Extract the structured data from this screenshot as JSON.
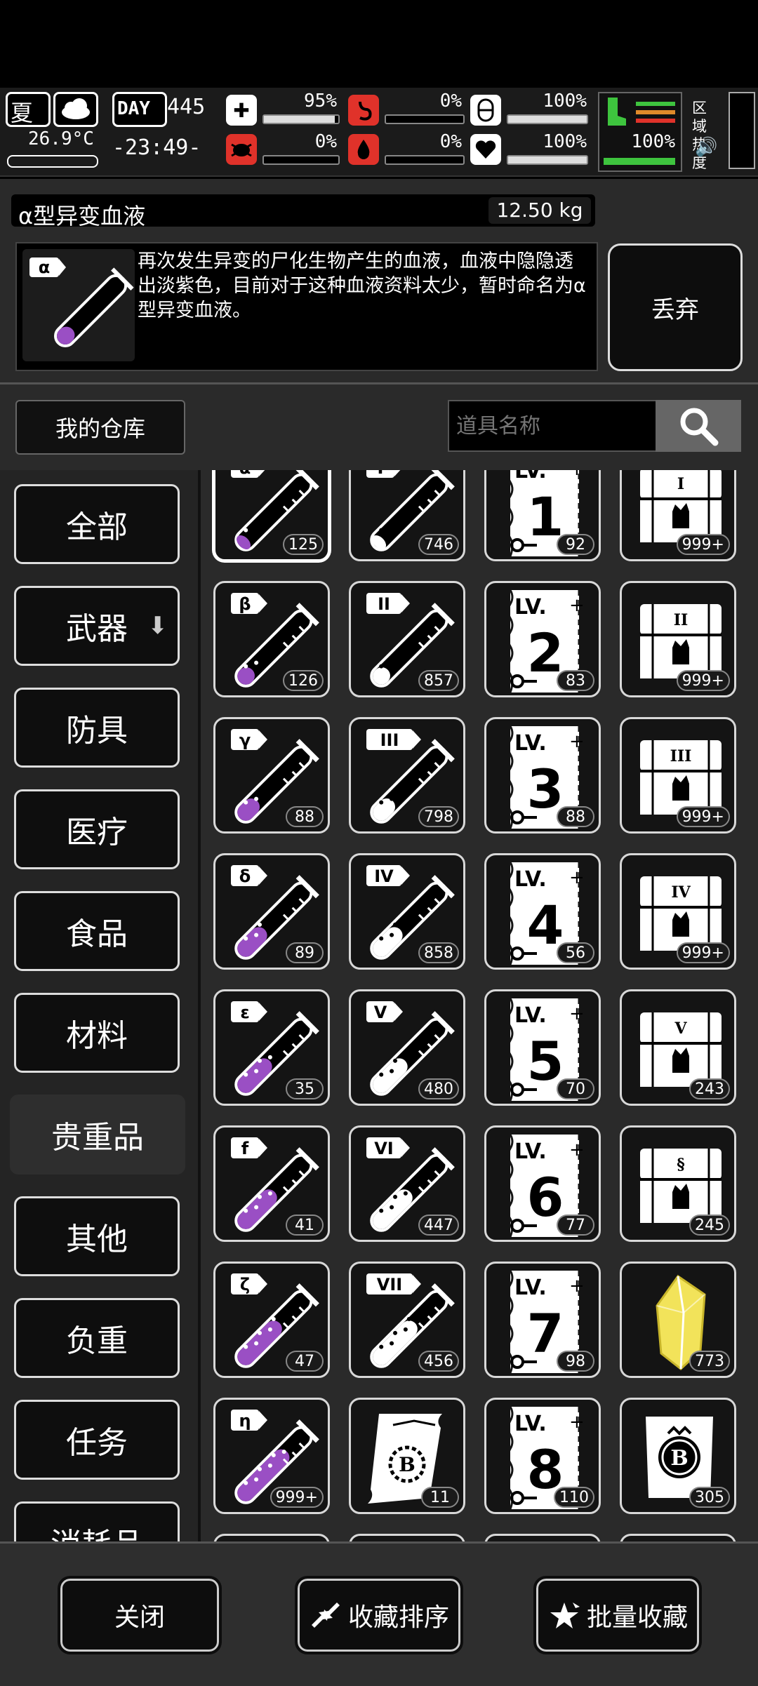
{
  "status": {
    "season": "夏",
    "temperature": "26.9°C",
    "day_label": "DAY",
    "day": "445",
    "time": "-23:49-",
    "health_pct": "95%",
    "hunger_pct": "0%",
    "stamina_pct": "100%",
    "infection_pct": "0%",
    "thirst_pct": "0%",
    "heart_pct": "100%",
    "leg_pct": "100%",
    "zone_heat_label": "区域热度"
  },
  "item": {
    "name": "α型异变血液",
    "weight": "12.50 kg",
    "description": "再次发生异变的尸化生物产生的血液，血液中隐隐透出淡紫色，目前对于这种血液资料太少，暂时命名为α型异变血液。",
    "discard_label": "丢弃"
  },
  "warehouse": {
    "title": "我的仓库",
    "search_placeholder": "道具名称"
  },
  "categories": [
    "全部",
    "武器",
    "防具",
    "医疗",
    "食品",
    "材料",
    "贵重品",
    "其他",
    "负重",
    "任务",
    "消耗品"
  ],
  "active_category": "贵重品",
  "grid": {
    "rows": [
      [
        {
          "type": "purple_tube",
          "symbol": "α",
          "count": "125",
          "fill": 0.15
        },
        {
          "type": "white_tube",
          "symbol": "I",
          "count": "746",
          "fill": 0.15
        },
        {
          "type": "scroll",
          "symbol": "1",
          "count": "92"
        },
        {
          "type": "chest",
          "symbol": "I",
          "count": "999+"
        }
      ],
      [
        {
          "type": "purple_tube",
          "symbol": "β",
          "count": "126",
          "fill": 0.25
        },
        {
          "type": "white_tube",
          "symbol": "II",
          "count": "857",
          "fill": 0.25
        },
        {
          "type": "scroll",
          "symbol": "2",
          "count": "83"
        },
        {
          "type": "chest",
          "symbol": "II",
          "count": "999+"
        }
      ],
      [
        {
          "type": "purple_tube",
          "symbol": "γ",
          "count": "88",
          "fill": 0.35
        },
        {
          "type": "white_tube",
          "symbol": "III",
          "count": "798",
          "fill": 0.35
        },
        {
          "type": "scroll",
          "symbol": "3",
          "count": "88"
        },
        {
          "type": "chest",
          "symbol": "III",
          "count": "999+"
        }
      ],
      [
        {
          "type": "purple_tube",
          "symbol": "δ",
          "count": "89",
          "fill": 0.5
        },
        {
          "type": "white_tube",
          "symbol": "IV",
          "count": "858",
          "fill": 0.5
        },
        {
          "type": "scroll",
          "symbol": "4",
          "count": "56"
        },
        {
          "type": "chest",
          "symbol": "IV",
          "count": "999+"
        }
      ],
      [
        {
          "type": "purple_tube",
          "symbol": "ε",
          "count": "35",
          "fill": 0.6
        },
        {
          "type": "white_tube",
          "symbol": "V",
          "count": "480",
          "fill": 0.6
        },
        {
          "type": "scroll",
          "symbol": "5",
          "count": "70"
        },
        {
          "type": "chest",
          "symbol": "V",
          "count": "243"
        }
      ],
      [
        {
          "type": "purple_tube",
          "symbol": "f",
          "count": "41",
          "fill": 0.7
        },
        {
          "type": "white_tube",
          "symbol": "VI",
          "count": "447",
          "fill": 0.7
        },
        {
          "type": "scroll",
          "symbol": "6",
          "count": "77"
        },
        {
          "type": "chest",
          "symbol": "§",
          "count": "245"
        }
      ],
      [
        {
          "type": "purple_tube",
          "symbol": "ζ",
          "count": "47",
          "fill": 0.8
        },
        {
          "type": "white_tube",
          "symbol": "VII",
          "count": "456",
          "fill": 0.8
        },
        {
          "type": "scroll",
          "symbol": "7",
          "count": "98"
        },
        {
          "type": "crystal",
          "symbol": "",
          "count": "773"
        }
      ],
      [
        {
          "type": "purple_tube",
          "symbol": "η",
          "count": "999+",
          "fill": 0.95
        },
        {
          "type": "map_scroll",
          "symbol": "B",
          "count": "11"
        },
        {
          "type": "scroll",
          "symbol": "8",
          "count": "110"
        },
        {
          "type": "badge",
          "symbol": "B",
          "count": "305"
        }
      ]
    ],
    "scroll_lv_label": "LV."
  },
  "bottom": {
    "close_label": "关闭",
    "sort_label": "收藏排序",
    "batch_label": "批量收藏"
  },
  "colors": {
    "purple_liquid": "#9a4fc4",
    "crystal_yellow": "#f2e35a",
    "leg_green": "#3ec43e"
  }
}
